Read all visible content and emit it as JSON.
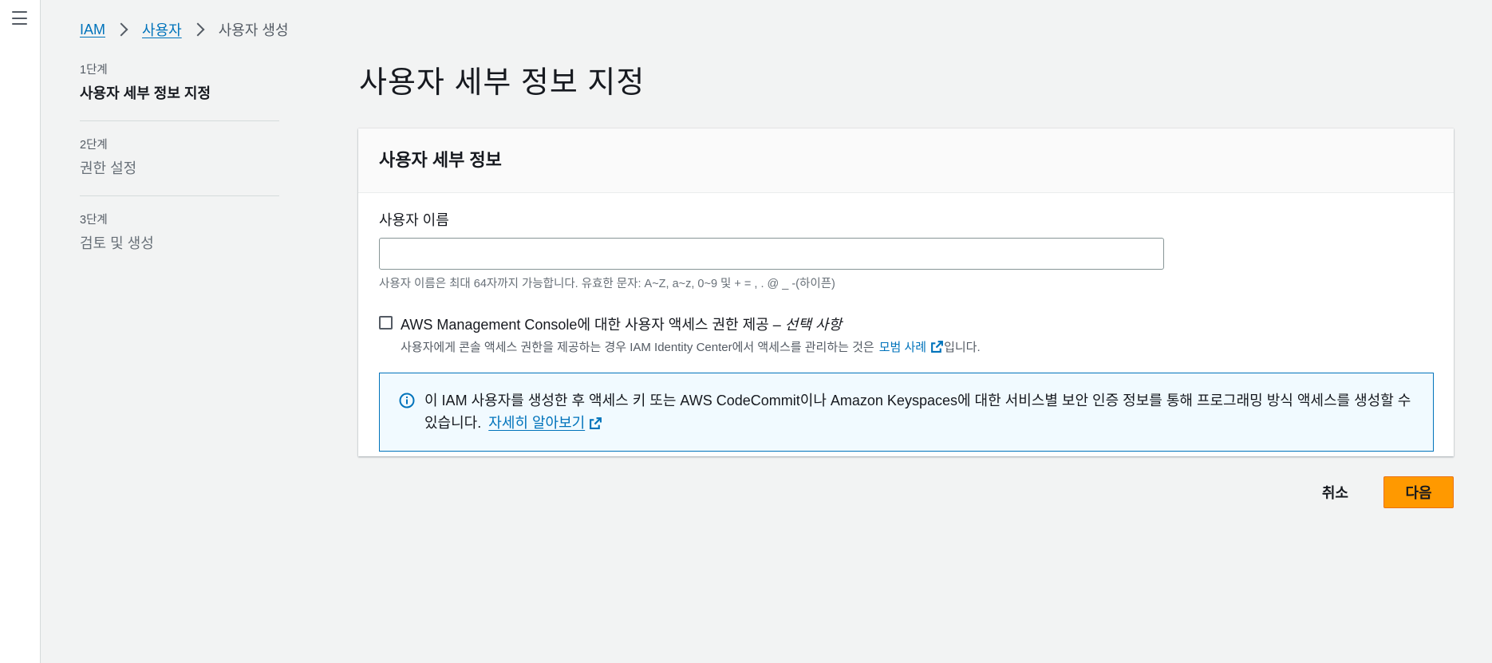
{
  "breadcrumb": {
    "items": [
      "IAM",
      "사용자"
    ],
    "current": "사용자 생성"
  },
  "steps": [
    {
      "num": "1단계",
      "title": "사용자 세부 정보 지정"
    },
    {
      "num": "2단계",
      "title": "권한 설정"
    },
    {
      "num": "3단계",
      "title": "검토 및 생성"
    }
  ],
  "page_title": "사용자 세부 정보 지정",
  "panel": {
    "header": "사용자 세부 정보",
    "username_label": "사용자 이름",
    "username_value": "",
    "username_hint": "사용자 이름은 최대 64자까지 가능합니다. 유효한 문자: A~Z, a~z, 0~9 및 + = , . @ _ -(하이픈)",
    "console_access_label": "AWS Management Console에 대한 사용자 액세스 권한 제공 –",
    "console_access_optional": "선택 사항",
    "console_access_desc": "사용자에게 콘솔 액세스 권한을 제공하는 경우 IAM Identity Center에서 액세스를 관리하는 것은",
    "best_practice_link": "모범 사례",
    "console_access_desc_suffix": "입니다.",
    "info_text": "이 IAM 사용자를 생성한 후 액세스 키 또는 AWS CodeCommit이나 Amazon Keyspaces에 대한 서비스별 보안 인증 정보를 통해 프로그래밍 방식 액세스를 생성할 수 있습니다.",
    "learn_more": "자세히 알아보기"
  },
  "actions": {
    "cancel": "취소",
    "next": "다음"
  },
  "colors": {
    "link": "#0073bb",
    "primary_button": "#ff9900",
    "info_bg": "#f1faff"
  },
  "icons": [
    "menu-icon",
    "chevron-right-icon",
    "external-link-icon",
    "info-icon"
  ]
}
